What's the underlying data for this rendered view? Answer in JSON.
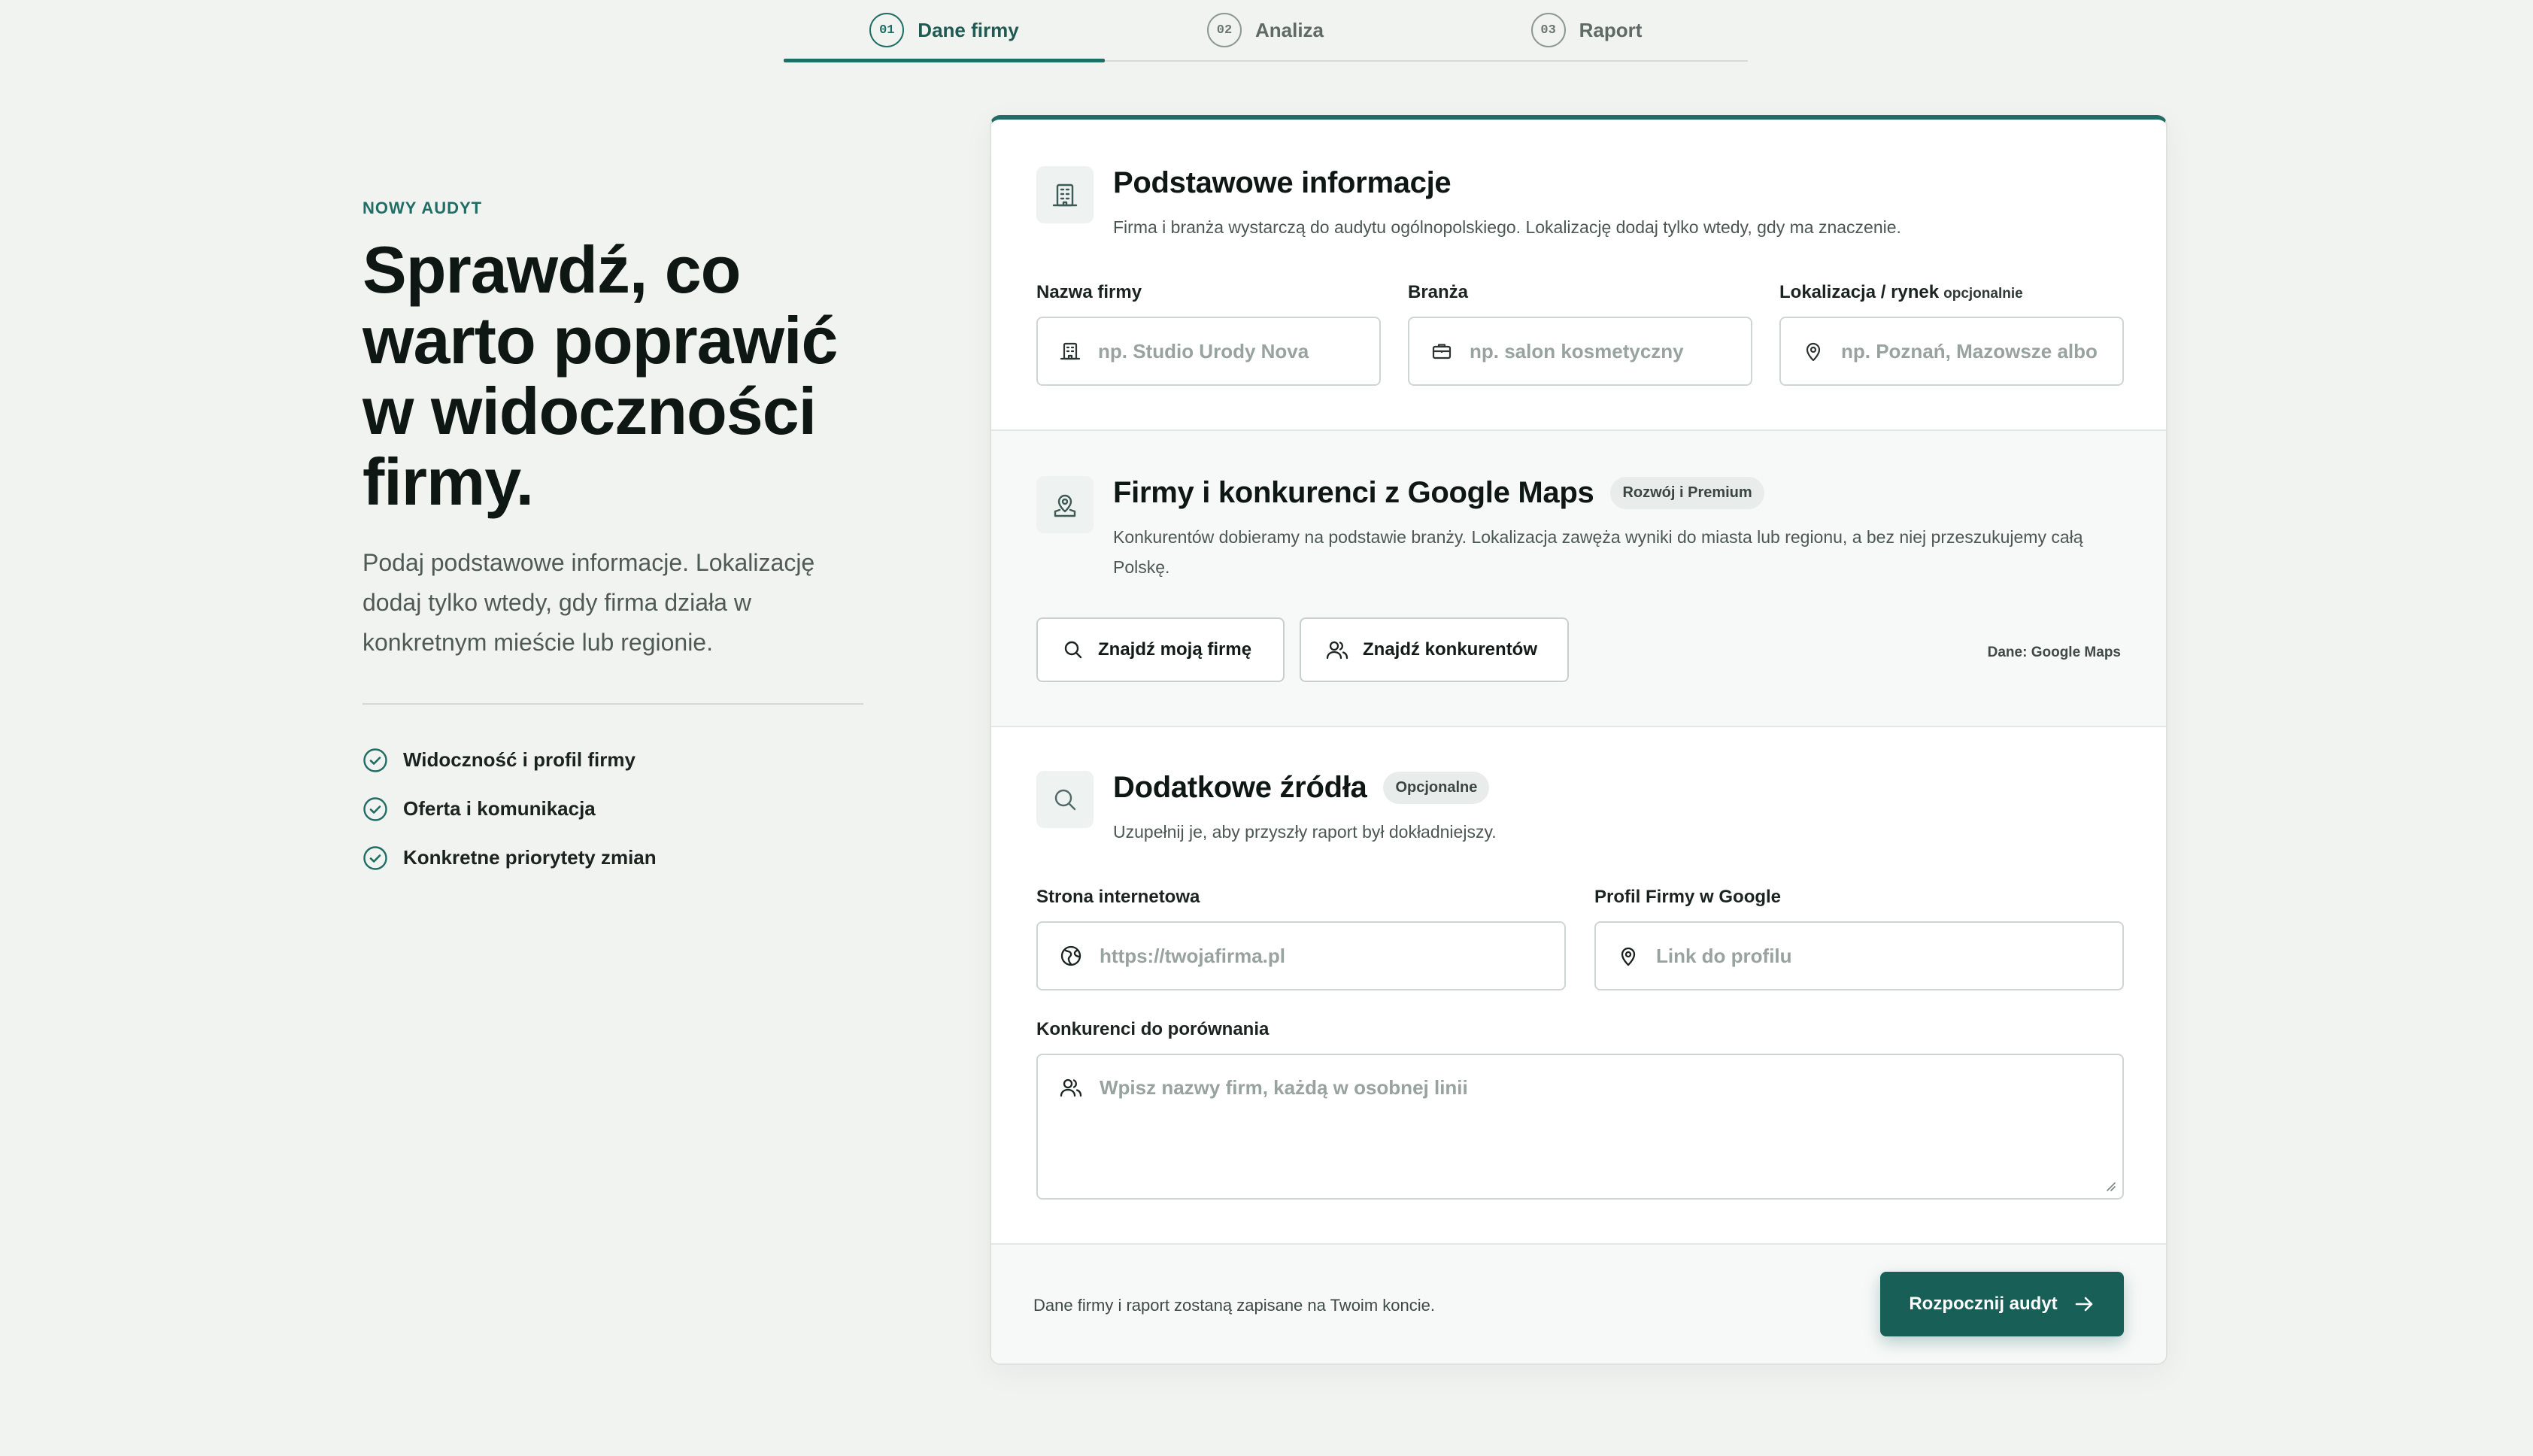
{
  "stepper": {
    "steps": [
      {
        "num": "01",
        "label": "Dane firmy"
      },
      {
        "num": "02",
        "label": "Analiza"
      },
      {
        "num": "03",
        "label": "Raport"
      }
    ],
    "active_step": 0
  },
  "intro": {
    "eyebrow": "NOWY AUDYT",
    "title": "Sprawdź, co warto poprawić w widoczności firmy.",
    "lead": "Podaj podstawowe informacje. Lokalizację dodaj tylko wtedy, gdy firma działa w konkretnym mieście lub regionie.",
    "checklist": [
      "Widoczność i profil firmy",
      "Oferta i komunikacja",
      "Konkretne priorytety zmian"
    ]
  },
  "basic_info": {
    "title": "Podstawowe informacje",
    "description": "Firma i branża wystarczą do audytu ogólnopolskiego. Lokalizację dodaj tylko wtedy, gdy ma znaczenie.",
    "company_name": {
      "label": "Nazwa firmy",
      "placeholder": "np. Studio Urody Nova"
    },
    "industry": {
      "label": "Branża",
      "placeholder": "np. salon kosmetyczny"
    },
    "location": {
      "label": "Lokalizacja / rynek",
      "optional": "opcjonalnie",
      "placeholder": "np. Poznań, Mazowsze albo"
    }
  },
  "maps": {
    "title": "Firmy i konkurenci z Google Maps",
    "badge": "Rozwój i Premium",
    "description": "Konkurentów dobieramy na podstawie branży. Lokalizacja zawęża wyniki do miasta lub regionu, a bez niej przeszukujemy całą Polskę.",
    "find_my_company": "Znajdź moją firmę",
    "find_competitors": "Znajdź konkurentów",
    "source": "Dane: Google Maps"
  },
  "extra": {
    "title": "Dodatkowe źródła",
    "badge": "Opcjonalne",
    "description": "Uzupełnij je, aby przyszły raport był dokładniejszy.",
    "website": {
      "label": "Strona internetowa",
      "placeholder": "https://twojafirma.pl"
    },
    "google_profile": {
      "label": "Profil Firmy w Google",
      "placeholder": "Link do profilu"
    },
    "competitors": {
      "label": "Konkurenci do porównania",
      "placeholder": "Wpisz nazwy firm, każdą w osobnej linii"
    }
  },
  "footer": {
    "note": "Dane firmy i raport zostaną zapisane na Twoim koncie.",
    "submit": "Rozpocznij audyt"
  },
  "colors": {
    "accent": "#1f6d64",
    "primary_button": "#175f57",
    "background": "#f1f3f1"
  },
  "icons": {
    "building": "building-icon",
    "briefcase": "briefcase-icon",
    "pin": "map-pin-icon",
    "search": "search-icon",
    "users": "users-icon",
    "globe": "globe-icon",
    "check": "check-circle-icon",
    "arrow": "arrow-right-icon"
  }
}
